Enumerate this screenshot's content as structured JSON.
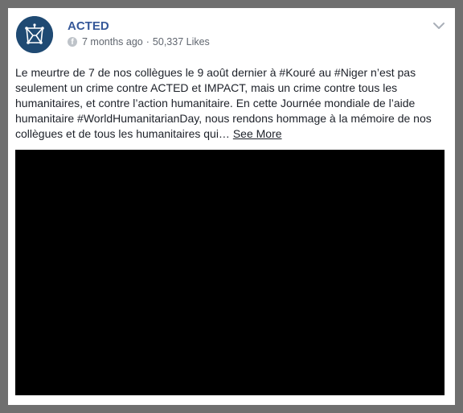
{
  "post": {
    "page_name": "ACTED",
    "time_ago": "7 months ago",
    "separator": "·",
    "likes": "50,337 Likes",
    "body": "Le meurtre de 7 de nos collègues le 9 août dernier à #Kouré au #Niger n’est pas seulement un crime contre ACTED et IMPACT, mais un crime contre tous les humanitaires, et contre l’action humanitaire. En cette Journée mondiale de l’aide humanitaire #WorldHumanitarianDay, nous rendons hommage à la mémoire de nos collègues et de tous les humanitaires qui…",
    "see_more": "See More",
    "platform_icon": "f"
  },
  "icons": {
    "avatar": "acted-logo",
    "platform": "facebook-icon",
    "menu": "chevron-down-icon"
  },
  "colors": {
    "page_name": "#365899",
    "avatar_bg": "#1f4a73",
    "meta_text": "#616770",
    "video_bg": "#000000"
  }
}
